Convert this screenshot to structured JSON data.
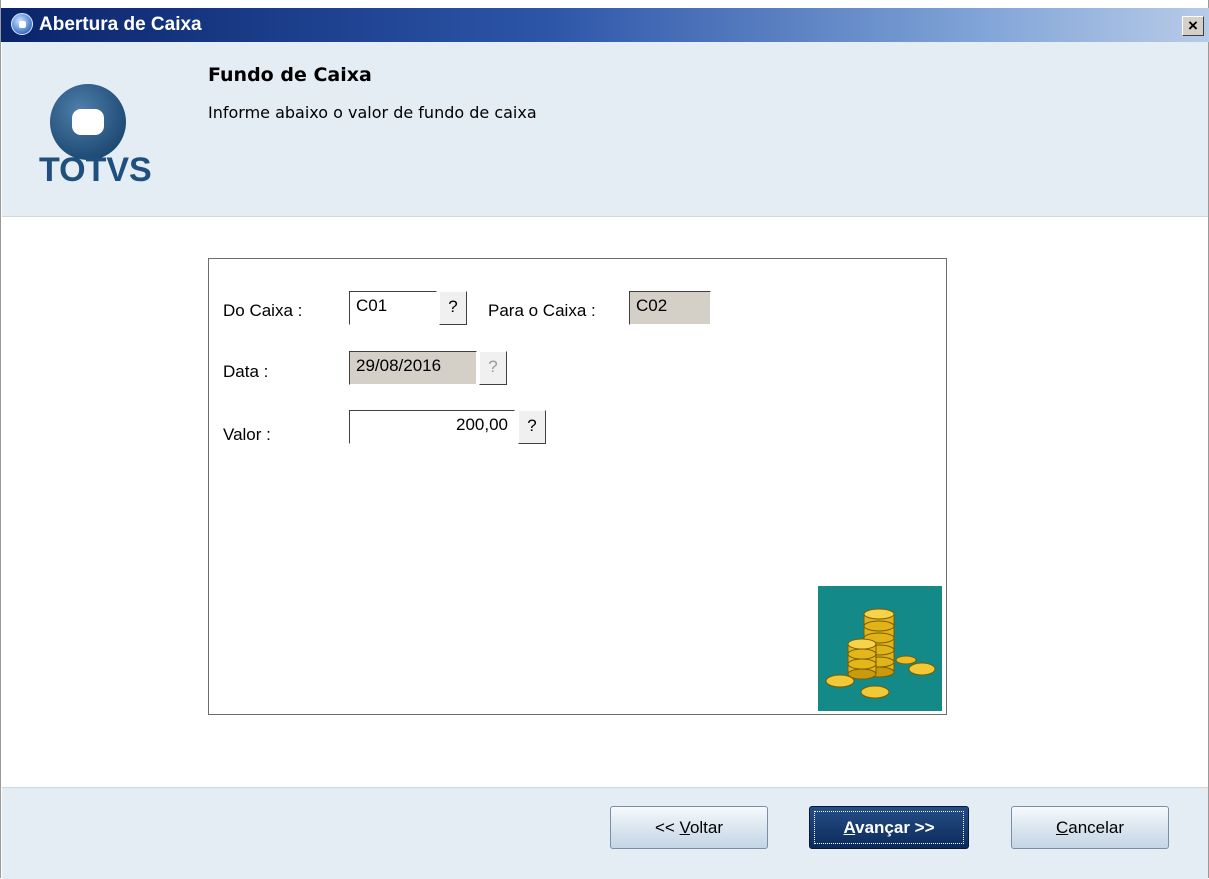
{
  "window": {
    "title": "Abertura de Caixa",
    "close_label": "×"
  },
  "header": {
    "logo_text": "TOTVS",
    "title": "Fundo de Caixa",
    "subtitle": "Informe abaixo o valor de fundo de caixa"
  },
  "form": {
    "do_caixa_label": "Do Caixa :",
    "do_caixa_value": "C01",
    "para_caixa_label": "Para o Caixa :",
    "para_caixa_value": "C02",
    "data_label": "Data  :",
    "data_value": "29/08/2016",
    "valor_label": "Valor :",
    "valor_value": "200,00",
    "help_glyph": "?"
  },
  "buttons": {
    "back": {
      "prefix": "<< ",
      "mnemonic": "V",
      "rest": "oltar"
    },
    "next": {
      "mnemonic": "A",
      "rest": "vançar >>"
    },
    "cancel": {
      "mnemonic": "C",
      "rest": "ancelar"
    }
  },
  "colors": {
    "title_bar": "#0a246a",
    "header_bg": "#e4ecf4",
    "coins_bg": "#138a88",
    "logo": "#1f4f7d"
  },
  "icons": {
    "window": "totvs-app-icon",
    "logo": "totvs-logo",
    "coins": "coins-stack-icon"
  }
}
